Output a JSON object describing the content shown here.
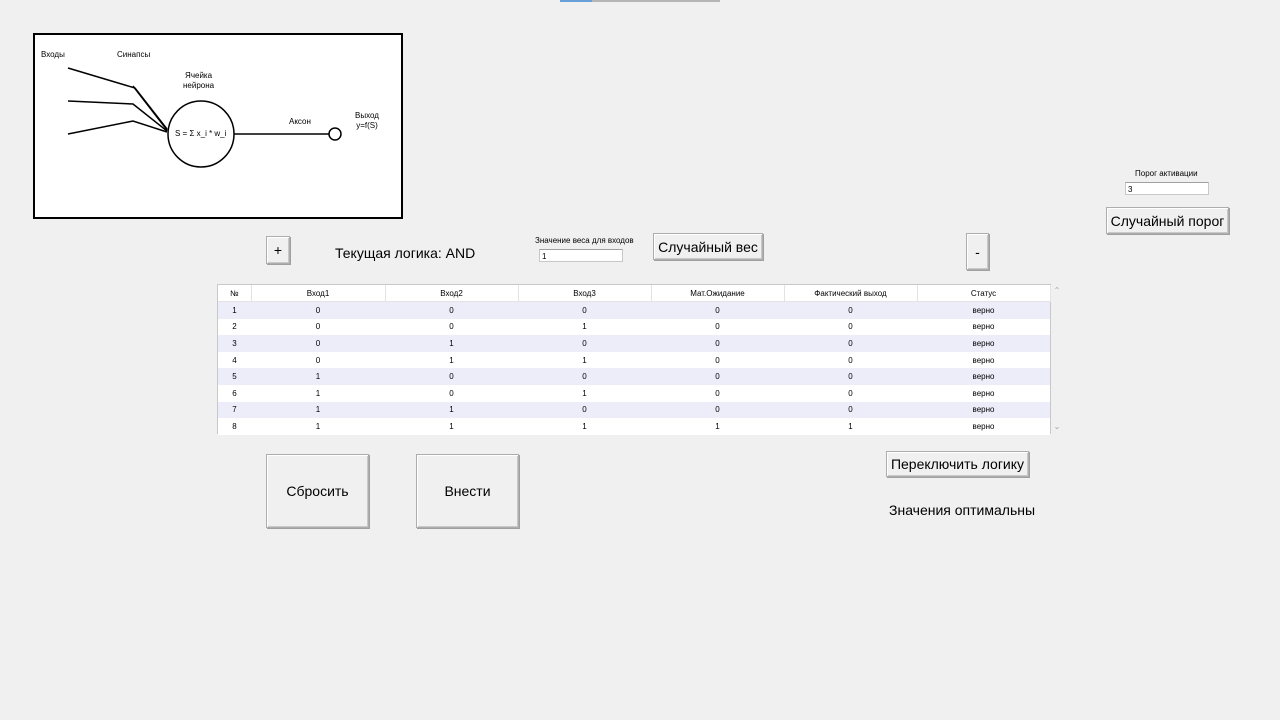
{
  "diagram": {
    "inputs_label": "Входы",
    "synapses_label": "Синапсы",
    "cell_label_line1": "Ячейка",
    "cell_label_line2": "нейрона",
    "formula": "S = Σ x_i * w_i",
    "axon_label": "Аксон",
    "output_label_line1": "Выход",
    "output_label_line2": "y=f(S)"
  },
  "threshold": {
    "label": "Порог активации",
    "value": "3",
    "random_button": "Случайный порог"
  },
  "controls": {
    "plus_button": "+",
    "current_logic": "Текущая логика: AND",
    "weight_label": "Значение веса для входов",
    "weight_value": "1",
    "random_weight_button": "Случайный вес",
    "minus_button": "-"
  },
  "table": {
    "columns": [
      "№",
      "Вход1",
      "Вход2",
      "Вход3",
      "Мат.Ожидание",
      "Фактический выход",
      "Статус"
    ],
    "rows": [
      [
        "1",
        "0",
        "0",
        "0",
        "0",
        "0",
        "верно"
      ],
      [
        "2",
        "0",
        "0",
        "1",
        "0",
        "0",
        "верно"
      ],
      [
        "3",
        "0",
        "1",
        "0",
        "0",
        "0",
        "верно"
      ],
      [
        "4",
        "0",
        "1",
        "1",
        "0",
        "0",
        "верно"
      ],
      [
        "5",
        "1",
        "0",
        "0",
        "0",
        "0",
        "верно"
      ],
      [
        "6",
        "1",
        "0",
        "1",
        "0",
        "0",
        "верно"
      ],
      [
        "7",
        "1",
        "1",
        "0",
        "0",
        "0",
        "верно"
      ],
      [
        "8",
        "1",
        "1",
        "1",
        "1",
        "1",
        "верно"
      ]
    ]
  },
  "actions": {
    "reset_button": "Сбросить",
    "apply_button": "Внести",
    "switch_logic_button": "Переключить логику",
    "status_text": "Значения оптимальны"
  }
}
